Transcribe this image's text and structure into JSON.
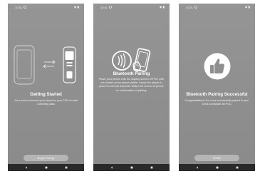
{
  "screens": [
    {
      "status_time": "10:31",
      "title": "Getting Started",
      "body": "You need to connect your phone to your POC to start collecting data",
      "button_label": "Begin Pairing"
    },
    {
      "status_time": "10:31",
      "title": "Bluetooth Pairing",
      "body": "Place your phone onto the display screen of POC with the screen of the phone visible. Leave the phone in place for several seconds. Watch the screen of phone for confirmation of pairing.",
      "button_label": ""
    },
    {
      "status_time": "10:31",
      "title": "Bluetooth Pairing Successful",
      "body": "Congratulations! You have successfully paired to your Drive-DenMobe 55 POC",
      "button_label": "DONE"
    }
  ],
  "colors": {
    "screen_background": "#8f8f8f",
    "button_background": "#b5b5b5",
    "nav_bar": "#2a2a2a",
    "text": "#ffffff"
  }
}
